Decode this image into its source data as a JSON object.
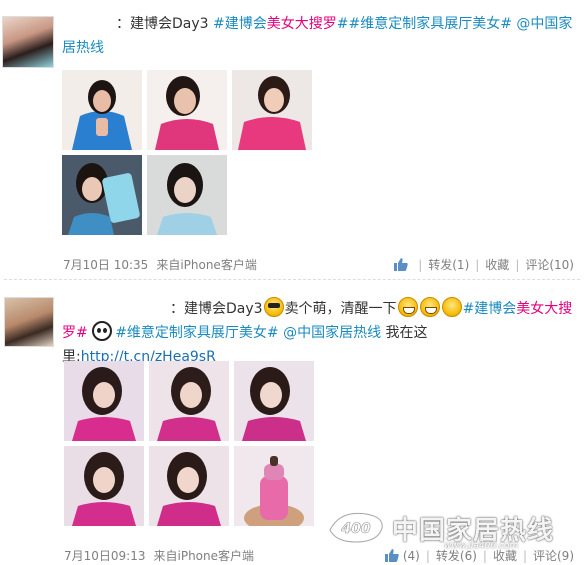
{
  "posts": [
    {
      "text_parts": {
        "a": "：建博会Day3 ",
        "b": "#建博会",
        "c": "美女大搜罗",
        "d": "#",
        "e": "#维意定制家具展厅美女#",
        "f": " @中国家居热线"
      },
      "photos": [
        {
          "colors": [
            "#f2ede8",
            "#2a7fd1",
            "#e8bca5",
            "#1d1512"
          ]
        },
        {
          "colors": [
            "#f5f0ee",
            "#e0367c",
            "#e9c2ad",
            "#221615"
          ]
        },
        {
          "colors": [
            "#ede8e6",
            "#e8397f",
            "#f0cdb9",
            "#2b1a16"
          ]
        },
        {
          "colors": [
            "#4a5a6a",
            "#8fd6ea",
            "#e9c8b6",
            "#1c1410"
          ]
        },
        {
          "colors": [
            "#d9dada",
            "#9fd0e6",
            "#ecd3c7",
            "#1a1412"
          ]
        }
      ],
      "date": "7月10日 10:35",
      "source": "来自iPhone客户端",
      "repost": "转发(1)",
      "favorite": "收藏",
      "comment": "评论(10)",
      "like_count": ""
    },
    {
      "text_parts": {
        "a": "：建博会Day3",
        "b": "卖个萌，清醒一下",
        "c": "#建博会",
        "d": "美女大",
        "e": "搜罗#",
        "f": "#维意定制家具展厅美女#",
        "g": " @中国家居热线",
        "h": " 我在这里:",
        "i": "http://t.cn/zHea9sR"
      },
      "photos": [
        {
          "colors": [
            "#e8dce8",
            "#d82d8e",
            "#efd2c8",
            "#2a1a1a"
          ]
        },
        {
          "colors": [
            "#efe3ea",
            "#d22f8c",
            "#f0d5cb",
            "#2c1c1a"
          ]
        },
        {
          "colors": [
            "#ece3ea",
            "#cc2f8a",
            "#f1d8cf",
            "#2a1b19"
          ]
        },
        {
          "colors": [
            "#eadee6",
            "#d32e8d",
            "#efd4ca",
            "#2b1b19"
          ]
        },
        {
          "colors": [
            "#eee2e9",
            "#d02d8b",
            "#f0d6cc",
            "#2a1a18"
          ]
        },
        {
          "colors": [
            "#f0e8ec",
            "#e86aa8",
            "#cfa07e",
            "#4a3228"
          ]
        }
      ],
      "date": "7月10日09:13",
      "source": "来自iPhone客户端",
      "like_count": "(4)",
      "repost": "转发(6)",
      "favorite": "收藏",
      "comment": "评论(9)"
    }
  ],
  "watermark": {
    "logo_text": "400",
    "title": "中国家居热线",
    "url": "www.jia400.com"
  },
  "colors": {
    "tag": "#1a8bbf",
    "highlight": "#e6007e",
    "link": "#1a6fb0",
    "meta": "#808080"
  },
  "icons": [
    "cool-emoji-icon",
    "grin-emoji-icon",
    "panda-icon",
    "thumbs-up-icon"
  ]
}
